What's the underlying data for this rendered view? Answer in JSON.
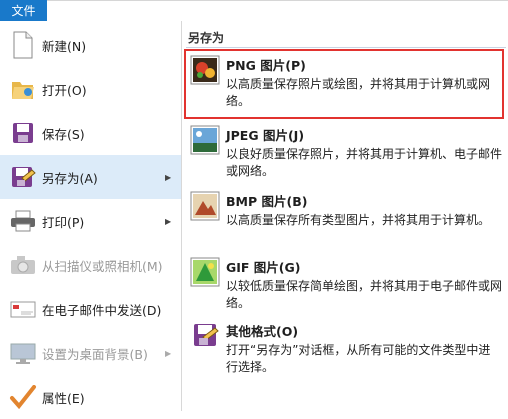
{
  "file_tab": "文件",
  "left_menu": [
    {
      "label": "新建(N)",
      "icon": "new-document-icon",
      "has_arrow": false,
      "state": "normal"
    },
    {
      "label": "打开(O)",
      "icon": "open-folder-icon",
      "has_arrow": false,
      "state": "normal"
    },
    {
      "label": "保存(S)",
      "icon": "save-disk-icon",
      "has_arrow": false,
      "state": "normal"
    },
    {
      "label": "另存为(A)",
      "icon": "save-as-icon",
      "has_arrow": true,
      "state": "selected"
    },
    {
      "label": "打印(P)",
      "icon": "printer-icon",
      "has_arrow": true,
      "state": "normal"
    },
    {
      "label": "从扫描仪或照相机(M)",
      "icon": "scanner-camera-icon",
      "has_arrow": false,
      "state": "disabled"
    },
    {
      "label": "在电子邮件中发送(D)",
      "icon": "email-icon",
      "has_arrow": false,
      "state": "normal"
    },
    {
      "label": "设置为桌面背景(B)",
      "icon": "desktop-background-icon",
      "has_arrow": true,
      "state": "disabled"
    },
    {
      "label": "属性(E)",
      "icon": "properties-check-icon",
      "has_arrow": false,
      "state": "normal"
    }
  ],
  "save_as_panel": {
    "header": "另存为",
    "items": [
      {
        "title": "PNG 图片(P)",
        "desc": "以高质量保存照片或绘图，并将其用于计算机或网络。",
        "icon": "png-image-icon",
        "highlighted": true
      },
      {
        "title": "JPEG 图片(J)",
        "desc": "以良好质量保存照片，并将其用于计算机、电子邮件或网络。",
        "icon": "jpeg-image-icon",
        "highlighted": false
      },
      {
        "title": "BMP 图片(B)",
        "desc": "以高质量保存所有类型图片，并将其用于计算机。",
        "icon": "bmp-image-icon",
        "highlighted": false
      },
      {
        "title": "GIF 图片(G)",
        "desc": "以较低质量保存简单绘图，并将其用于电子邮件或网络。",
        "icon": "gif-image-icon",
        "highlighted": false
      },
      {
        "title": "其他格式(O)",
        "desc": "打开“另存为”对话框，从所有可能的文件类型中进行选择。",
        "icon": "other-formats-icon",
        "highlighted": false
      }
    ]
  },
  "colors": {
    "accent": "#1979ca",
    "selected_bg": "#dcebf9",
    "highlight_border": "#e2332f"
  }
}
